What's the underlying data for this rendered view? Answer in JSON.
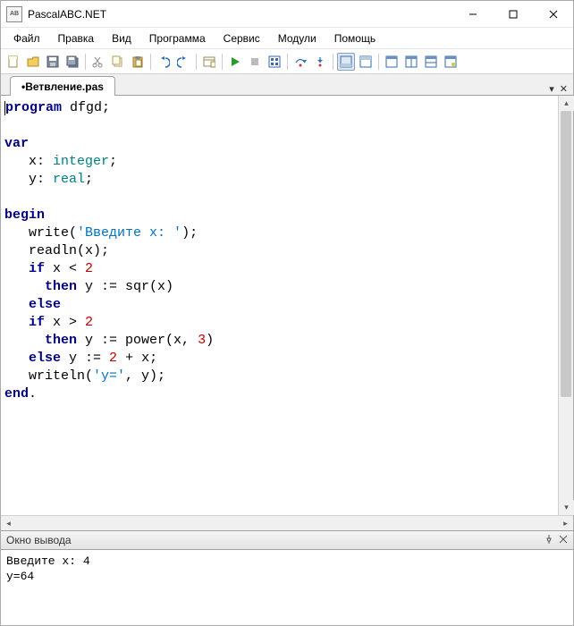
{
  "app": {
    "title": "PascalABC.NET"
  },
  "menu": {
    "items": [
      "Файл",
      "Правка",
      "Вид",
      "Программа",
      "Сервис",
      "Модули",
      "Помощь"
    ]
  },
  "toolbar_icons": [
    "new",
    "open",
    "save",
    "saveall",
    "cut",
    "copy",
    "paste",
    "undo",
    "redo",
    "spacer",
    "run",
    "stop",
    "stepover",
    "stepinto",
    "spacer",
    "breakpoint",
    "build",
    "spacer",
    "panel-a",
    "panel-b",
    "spacer",
    "win1",
    "win2",
    "win3",
    "win4"
  ],
  "tab": {
    "label": "•Ветвление.pas"
  },
  "code": {
    "line1_kw": "program",
    "line1_rest": " dfgd;",
    "var_kw": "var",
    "line_x_indent": "   ",
    "line_x_id": "x: ",
    "line_x_type": "integer",
    "line_x_semi": ";",
    "line_y_indent": "   ",
    "line_y_id": "y: ",
    "line_y_type": "real",
    "line_y_semi": ";",
    "begin_kw": "begin",
    "write_indent": "   ",
    "write_call": "write(",
    "write_str": "'Введите x: '",
    "write_close": ");",
    "readln_line": "   readln(x);",
    "if1_indent": "   ",
    "if1_kw": "if",
    "if1_rest": " x < ",
    "if1_num": "2",
    "then1_indent": "     ",
    "then1_kw": "then",
    "then1_rest": " y := sqr(x)",
    "else1_indent": "   ",
    "else1_kw": "else",
    "if2_indent": "   ",
    "if2_kw": "if",
    "if2_rest": " x > ",
    "if2_num": "2",
    "then2_indent": "     ",
    "then2_kw": "then",
    "then2_rest": " y := power(x, ",
    "then2_num": "3",
    "then2_close": ")",
    "else2_indent": "   ",
    "else2_kw": "else",
    "else2_rest": " y := ",
    "else2_num": "2",
    "else2_tail": " + x;",
    "writeln_indent": "   ",
    "writeln_call": "writeln(",
    "writeln_str": "'y='",
    "writeln_rest": ", y);",
    "end_kw": "end",
    "end_dot": "."
  },
  "output": {
    "title": "Окно вывода",
    "line1": "Введите x: 4",
    "line2": "y=64"
  }
}
